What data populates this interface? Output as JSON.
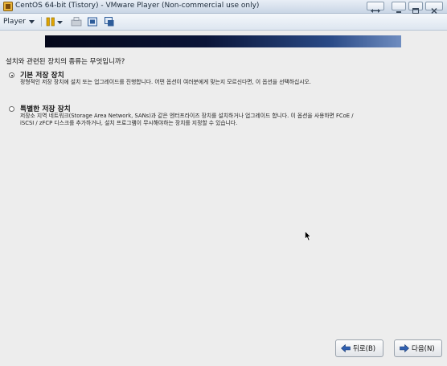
{
  "window": {
    "title": "CentOS 64-bit (Tistory) - VMware Player (Non-commercial use only)"
  },
  "toolbar": {
    "player_label": "Player",
    "icons": [
      "pause-icon",
      "send-ctrl-alt-del-icon",
      "fullscreen-icon",
      "unity-icon"
    ]
  },
  "installer": {
    "question": "설치와 관련된 장치의 종류는 무엇입니까?",
    "options": [
      {
        "title": "기본 저장 장치",
        "description": "정형적인 저장 장치에 설치 또는 업그레이드를 진행합니다. 어떤 옵션이 여러분에게 맞는지 모르신다면, 이 옵션을 선택하십시오.",
        "selected": true
      },
      {
        "title": "특별한 저장 장치",
        "description": "저장소 지역 네트워크(Storage Area Network, SANs)과 같은 엔터프라이즈 장치를 설치하거나 업그레이드 합니다. 이 옵션을 사용하면 FCoE / iSCSI / zFCP 디스크를 추가하거나, 설치 프로그램이 무시해야하는 장치를 지정할 수 있습니다.",
        "selected": false
      }
    ],
    "back_label": "뒤로(B)",
    "next_label": "다음(N)"
  },
  "colors": {
    "accent_arrow": "#2f5fb0",
    "banner_dark": "#05081a",
    "background": "#ededed"
  }
}
